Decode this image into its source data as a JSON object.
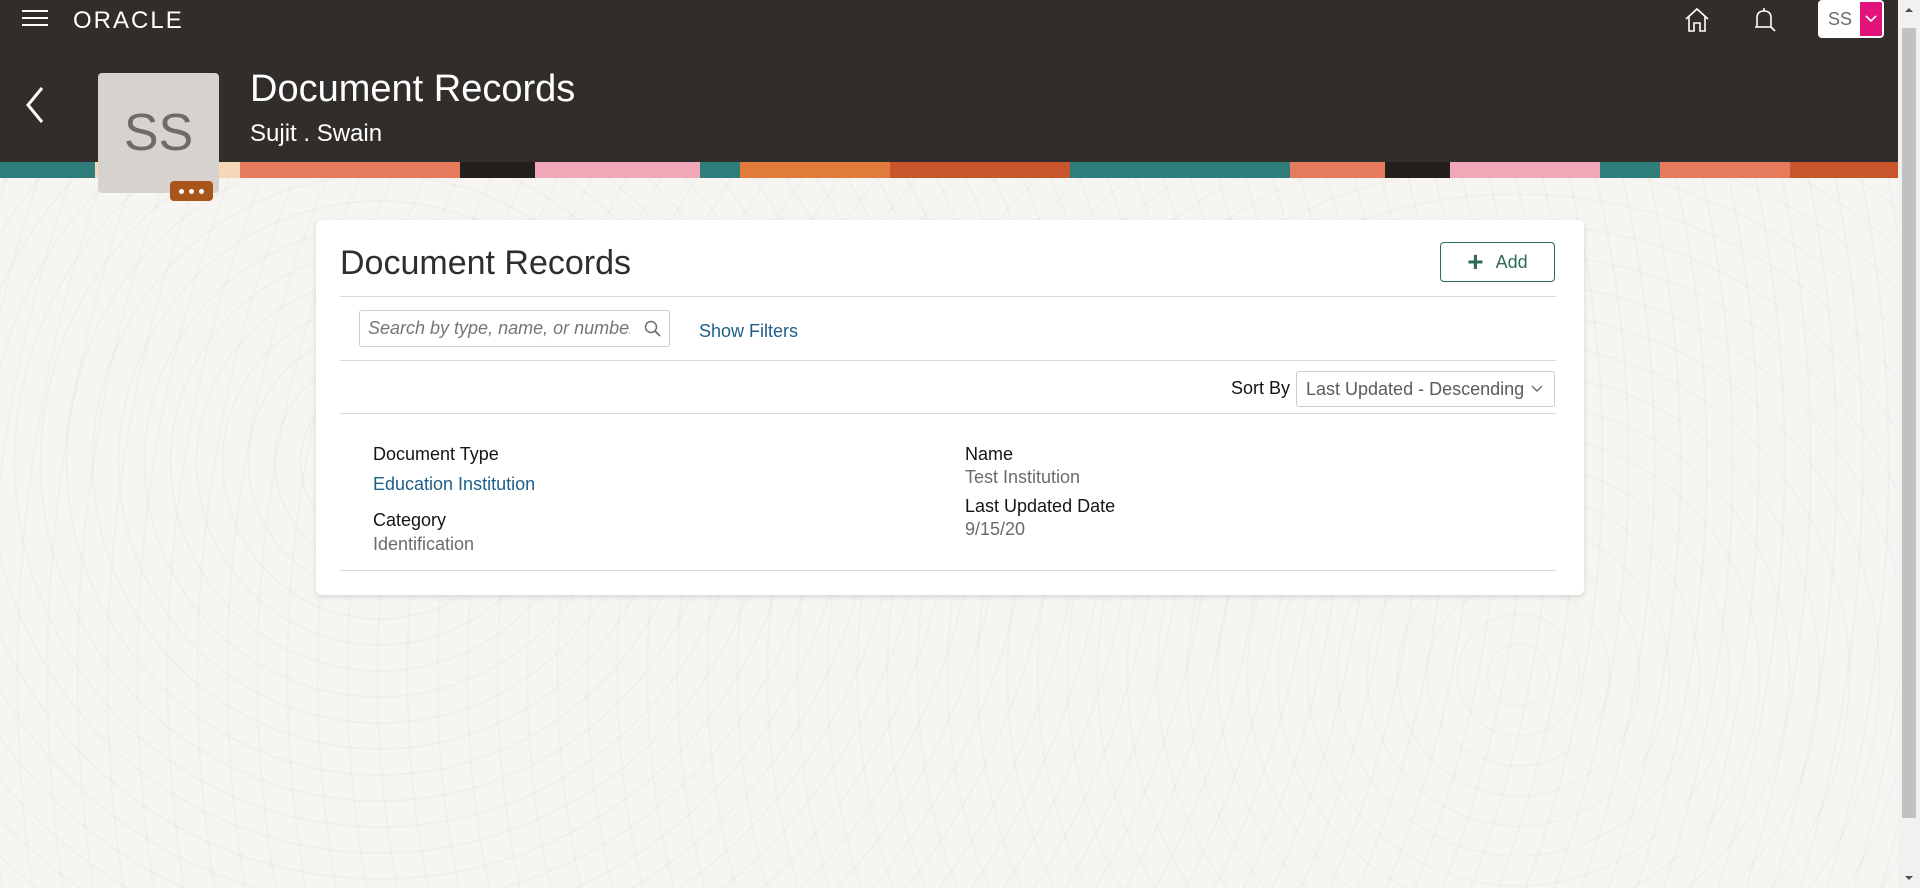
{
  "header": {
    "logo": "ORACLE",
    "user_initials": "SS",
    "page_title": "Document Records",
    "person_name": "Sujit . Swain",
    "avatar_initials": "SS"
  },
  "card": {
    "title": "Document Records",
    "add_label": "Add",
    "search": {
      "placeholder": "Search by type, name, or number"
    },
    "show_filters_label": "Show Filters",
    "sort": {
      "label": "Sort By",
      "selected": "Last Updated - Descending"
    }
  },
  "record": {
    "document_type_label": "Document Type",
    "document_type_value": "Education Institution",
    "category_label": "Category",
    "category_value": "Identification",
    "name_label": "Name",
    "name_value": "Test Institution",
    "last_updated_label": "Last Updated Date",
    "last_updated_value": "9/15/20"
  },
  "colors": {
    "header_bg": "#312d2a",
    "link": "#1d5f88",
    "accent_pink": "#e3137c",
    "accent_brown": "#a9541b",
    "add_button": "#2e6b57"
  }
}
